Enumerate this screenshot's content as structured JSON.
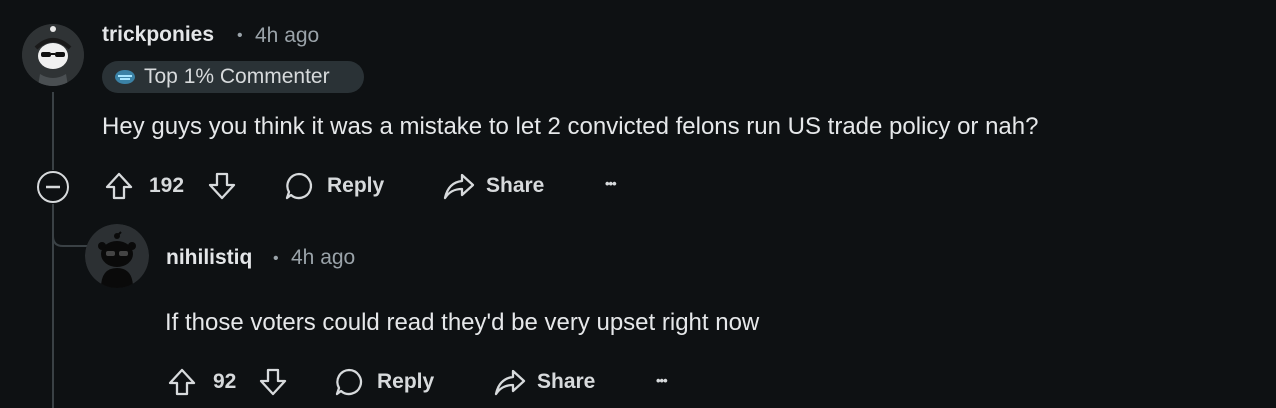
{
  "comment": {
    "username": "trickponies",
    "separator": "•",
    "time": "4h ago",
    "flair": "Top 1% Commenter",
    "body": "Hey guys you think it was a mistake to let 2 convicted felons run US trade policy or nah?",
    "votes": "192",
    "reply_label": "Reply",
    "share_label": "Share",
    "more_label": "•••"
  },
  "reply": {
    "username": "nihilistiq",
    "separator": "•",
    "time": "4h ago",
    "body": "If those voters could read they'd be very upset right now",
    "votes": "92",
    "reply_label": "Reply",
    "share_label": "Share",
    "more_label": "•••"
  },
  "colors": {
    "background": "#0e1113",
    "text": "#d7dadc",
    "muted": "#9aa3a9",
    "flair_bg": "#2a3236",
    "thread_line": "#3a4145"
  },
  "icons": [
    "upvote-icon",
    "downvote-icon",
    "comment-icon",
    "share-icon",
    "more-icon",
    "collapse-icon"
  ]
}
